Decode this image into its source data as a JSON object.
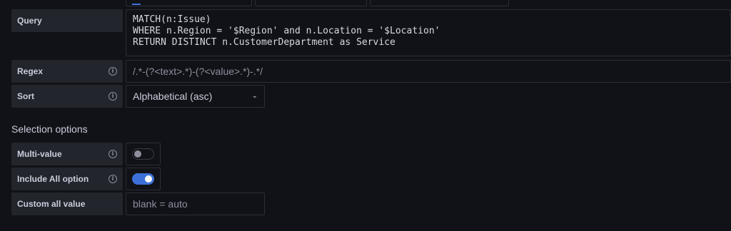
{
  "query": {
    "label": "Query",
    "lines": [
      "MATCH(n:Issue)",
      "WHERE n.Region = '$Region' and n.Location = '$Location'",
      "RETURN DISTINCT n.CustomerDepartment as Service"
    ]
  },
  "regex": {
    "label": "Regex",
    "value": "/.*-(?<text>.*)-(?<value>.*)-.*/"
  },
  "sort": {
    "label": "Sort",
    "selected": "Alphabetical (asc)"
  },
  "selection_options": {
    "title": "Selection options",
    "multi_value": {
      "label": "Multi-value",
      "enabled": false
    },
    "include_all": {
      "label": "Include All option",
      "enabled": true
    },
    "custom_all": {
      "label": "Custom all value",
      "placeholder": "blank = auto"
    }
  },
  "colors": {
    "accent": "#3d71d9",
    "label_bg": "#22252b",
    "background": "#111217"
  }
}
